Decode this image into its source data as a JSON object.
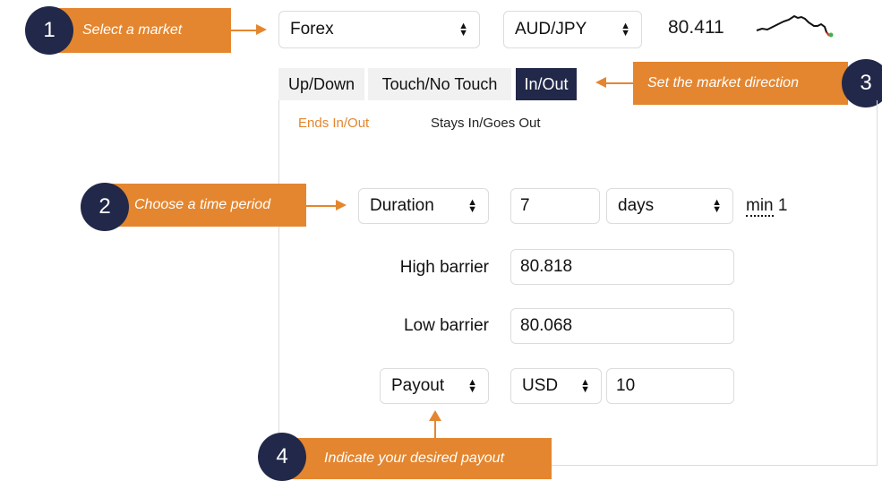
{
  "callouts": {
    "c1": {
      "number": "1",
      "text": "Select a market"
    },
    "c2": {
      "number": "2",
      "text": "Choose a time period"
    },
    "c3": {
      "number": "3",
      "text": "Set the market direction"
    },
    "c4": {
      "number": "4",
      "text": "Indicate your desired payout"
    }
  },
  "market": {
    "category": "Forex",
    "symbol": "AUD/JPY",
    "price": "80.411"
  },
  "tabs": [
    "Up/Down",
    "Touch/No Touch",
    "In/Out"
  ],
  "active_tab_index": 2,
  "subtabs": [
    "Ends In/Out",
    "Stays In/Goes Out"
  ],
  "active_subtab_index": 0,
  "form": {
    "duration_label": "Duration",
    "duration_value": "7",
    "duration_unit": "days",
    "min_abbr": "min",
    "min_value": "1",
    "high_barrier_label": "High barrier",
    "high_barrier_value": "80.818",
    "low_barrier_label": "Low barrier",
    "low_barrier_value": "80.068",
    "payout_label": "Payout",
    "currency": "USD",
    "amount": "10"
  },
  "colors": {
    "accent_orange": "#e4862f",
    "navy": "#222849",
    "subtab_active": "#e4862f"
  },
  "icons": {
    "select_arrows": "up-down-caret",
    "sparkline": "price-sparkline"
  }
}
